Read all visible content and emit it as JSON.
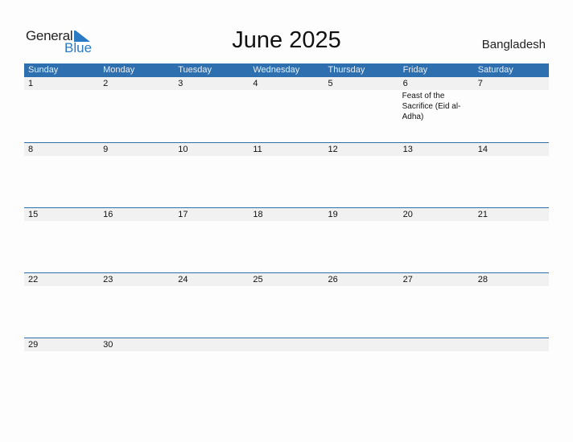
{
  "logo": {
    "general": "General",
    "blue": "Blue"
  },
  "title": "June 2025",
  "country": "Bangladesh",
  "weekdays": [
    "Sunday",
    "Monday",
    "Tuesday",
    "Wednesday",
    "Thursday",
    "Friday",
    "Saturday"
  ],
  "weeks": [
    [
      {
        "d": "1"
      },
      {
        "d": "2"
      },
      {
        "d": "3"
      },
      {
        "d": "4"
      },
      {
        "d": "5"
      },
      {
        "d": "6",
        "event": "Feast of the Sacrifice (Eid al-Adha)"
      },
      {
        "d": "7"
      }
    ],
    [
      {
        "d": "8"
      },
      {
        "d": "9"
      },
      {
        "d": "10"
      },
      {
        "d": "11"
      },
      {
        "d": "12"
      },
      {
        "d": "13"
      },
      {
        "d": "14"
      }
    ],
    [
      {
        "d": "15"
      },
      {
        "d": "16"
      },
      {
        "d": "17"
      },
      {
        "d": "18"
      },
      {
        "d": "19"
      },
      {
        "d": "20"
      },
      {
        "d": "21"
      }
    ],
    [
      {
        "d": "22"
      },
      {
        "d": "23"
      },
      {
        "d": "24"
      },
      {
        "d": "25"
      },
      {
        "d": "26"
      },
      {
        "d": "27"
      },
      {
        "d": "28"
      }
    ],
    [
      {
        "d": "29"
      },
      {
        "d": "30"
      },
      {
        "d": ""
      },
      {
        "d": ""
      },
      {
        "d": ""
      },
      {
        "d": ""
      },
      {
        "d": ""
      }
    ]
  ],
  "colors": {
    "accent": "#2e6fb0",
    "logo_blue": "#2a7bc4",
    "date_strip": "#f1f1f1"
  }
}
